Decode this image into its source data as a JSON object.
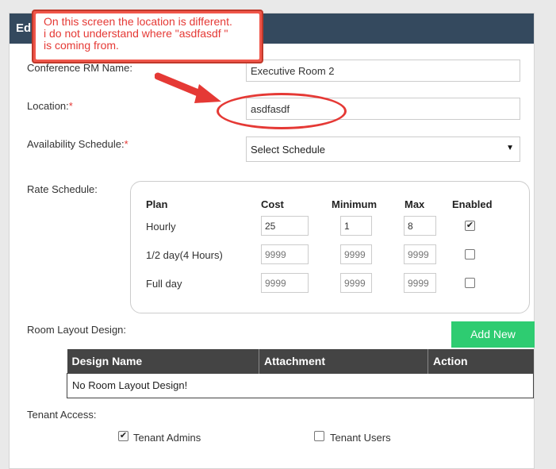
{
  "panel": {
    "title_visible": "Edi"
  },
  "form": {
    "conference_name_label": "Conference RM Name:",
    "conference_name_value": "Executive Room 2",
    "location_label": "Location:",
    "location_value": "asdfasdf",
    "availability_label": "Availability Schedule:",
    "availability_value": "Select Schedule",
    "required_mark": "*",
    "rate_label": "Rate Schedule:"
  },
  "rate_table": {
    "headers": [
      "Plan",
      "Cost",
      "Minimum",
      "Max",
      "Enabled"
    ],
    "rows": [
      {
        "plan": "Hourly",
        "cost": "25",
        "minimum": "1",
        "max": "8",
        "cost_ph": "",
        "min_ph": "",
        "max_ph": "",
        "enabled": true
      },
      {
        "plan": "1/2 day(4 Hours)",
        "cost": "",
        "minimum": "",
        "max": "",
        "cost_ph": "9999",
        "min_ph": "9999",
        "max_ph": "9999",
        "enabled": false
      },
      {
        "plan": "Full day",
        "cost": "",
        "minimum": "",
        "max": "",
        "cost_ph": "9999",
        "min_ph": "9999",
        "max_ph": "9999",
        "enabled": false
      }
    ]
  },
  "layout_design": {
    "label": "Room Layout Design:",
    "add_button": "Add New",
    "columns": [
      "Design Name",
      "Attachment",
      "Action"
    ],
    "empty_text": "No Room Layout Design!"
  },
  "tenant": {
    "label": "Tenant Access:",
    "admins_label": "Tenant Admins",
    "admins_checked": true,
    "users_label": "Tenant Users",
    "users_checked": false
  },
  "annotation": {
    "line1": "On this screen the location is different.",
    "line2": "i do not understand where \"asdfasdf \"",
    "line3": "is coming from."
  },
  "colors": {
    "header_bg": "#34495e",
    "add_button_bg": "#2ecc71",
    "annotation_red": "#e53935",
    "table_header_bg": "#444444"
  }
}
